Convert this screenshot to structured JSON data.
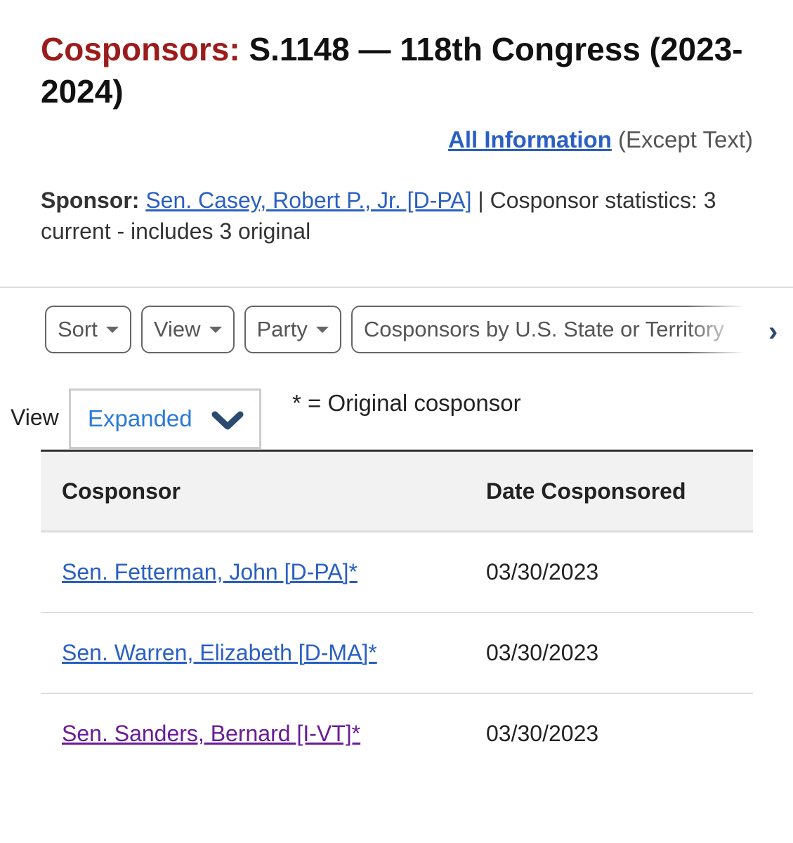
{
  "title": {
    "label": "Cosponsors:",
    "text": "S.1148 — 118th Congress (2023-2024)"
  },
  "all_info": {
    "link": "All Information",
    "suffix": "(Except Text)"
  },
  "sponsor": {
    "label": "Sponsor:",
    "name": "Sen. Casey, Robert P., Jr. [D-PA]",
    "stats": "| Cosponsor statistics: 3 current - includes 3 original"
  },
  "filters": [
    {
      "label": "Sort"
    },
    {
      "label": "View"
    },
    {
      "label": "Party"
    },
    {
      "label": "Cosponsors by U.S. State or Territory"
    }
  ],
  "view": {
    "label": "View",
    "selected": "Expanded"
  },
  "legend": "* = Original cosponsor",
  "table": {
    "headers": [
      "Cosponsor",
      "Date Cosponsored"
    ],
    "rows": [
      {
        "name": "Sen. Fetterman, John [D-PA]*",
        "date": "03/30/2023"
      },
      {
        "name": "Sen. Warren, Elizabeth [D-MA]*",
        "date": "03/30/2023"
      },
      {
        "name": "Sen. Sanders, Bernard [I-VT]*",
        "date": "03/30/2023"
      }
    ]
  },
  "colors": {
    "title_label": "#9b1c1c",
    "link": "#2a5fc4",
    "visited_link": "#6a1b9a"
  }
}
